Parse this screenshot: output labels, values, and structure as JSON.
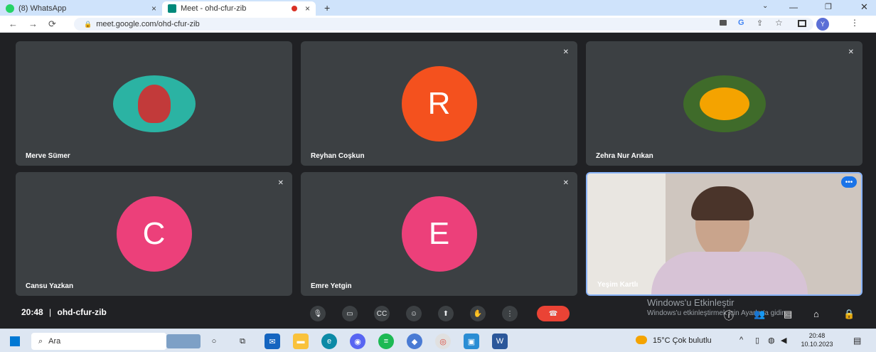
{
  "browser": {
    "tabs": [
      {
        "label": "(8) WhatsApp",
        "close": "×"
      },
      {
        "label": "Meet - ohd-cfur-zib",
        "close": "×"
      }
    ],
    "new_tab": "+",
    "url": "meet.google.com/ohd-cfur-zib",
    "profile_initial": "Y"
  },
  "meet": {
    "participants": [
      {
        "name": "Merve Sümer",
        "type": "photo",
        "muted": false
      },
      {
        "name": "Reyhan Coşkun",
        "type": "initial",
        "initial": "R",
        "color": "#f4511e",
        "muted": true
      },
      {
        "name": "Zehra Nur Arıkan",
        "type": "photo",
        "muted": true
      },
      {
        "name": "Cansu Yazkan",
        "type": "initial",
        "initial": "C",
        "color": "#ec407a",
        "muted": true
      },
      {
        "name": "Emre Yetgin",
        "type": "initial",
        "initial": "E",
        "color": "#ec407a",
        "muted": true
      },
      {
        "name": "Yeşim Kartlı",
        "type": "video",
        "muted": false
      }
    ],
    "time": "20:48",
    "separator": "|",
    "meeting_code": "ohd-cfur-zib",
    "controls": [
      "mic-icon",
      "camera-icon",
      "captions-icon",
      "emoji-icon",
      "present-icon",
      "hand-icon",
      "more-icon",
      "end-call-icon"
    ],
    "watermark_title": "Windows'u Etkinleştir",
    "watermark_sub": "Windows'u etkinleştirmek için Ayarlar'a gidin."
  },
  "taskbar": {
    "search_label": "Ara",
    "weather": "15°C Çok bulutlu",
    "clock_time": "20:48",
    "clock_date": "10.10.2023"
  },
  "colors": {
    "meet_bg": "#202124",
    "tile_bg": "#3c4043",
    "end_call": "#ea4335",
    "active_tile_border": "#8ab4f8"
  }
}
